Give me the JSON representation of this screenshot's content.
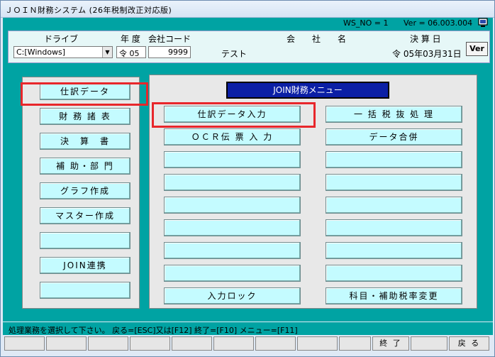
{
  "window": {
    "title": "ＪＯＩＮ財務システム (26年税制改正対応版)"
  },
  "info": {
    "ws_no": "WS_NO = 1",
    "version": "Ver = 06.003.004"
  },
  "header": {
    "drive_label": "ドライブ",
    "drive_value": "C:[Windows]",
    "year_label": "年 度",
    "year_value": "令 05",
    "company_code_label": "会社コード",
    "company_code_value": "9999",
    "company_name_label": "会　　社　　名",
    "company_name_value": "テスト",
    "closing_label": "決 算 日",
    "closing_value": "令 05年03月31日",
    "ver_button": "Ver"
  },
  "left_menu": [
    "仕訳データ",
    "財 務 諸 表",
    "決　算　書",
    "補 助・部 門",
    "グラフ作成",
    "マスター作成",
    "",
    "JOIN連携",
    ""
  ],
  "main_menu": {
    "title": "JOIN財務メニュー",
    "left_column": [
      "仕訳データ入力",
      "ＯＣＲ伝 票 入 力",
      "",
      "",
      "",
      "",
      "",
      "",
      "入力ロック"
    ],
    "right_column": [
      "一 括 税 抜 処 理",
      "データ合併",
      "",
      "",
      "",
      "",
      "",
      "",
      "科目・補助税率変更"
    ]
  },
  "status": {
    "message": "処理業務を選択して下さい。 戻る=[ESC]又は[F12] 終了=[F10] メニュー=[F11]"
  },
  "fkeys": {
    "f10": "終 了",
    "f12": "戻 る"
  },
  "colors": {
    "teal": "#00a3a3",
    "button": "#c4fbff",
    "menu_title_bg": "#0b1fa5",
    "highlight": "#e8262b"
  }
}
